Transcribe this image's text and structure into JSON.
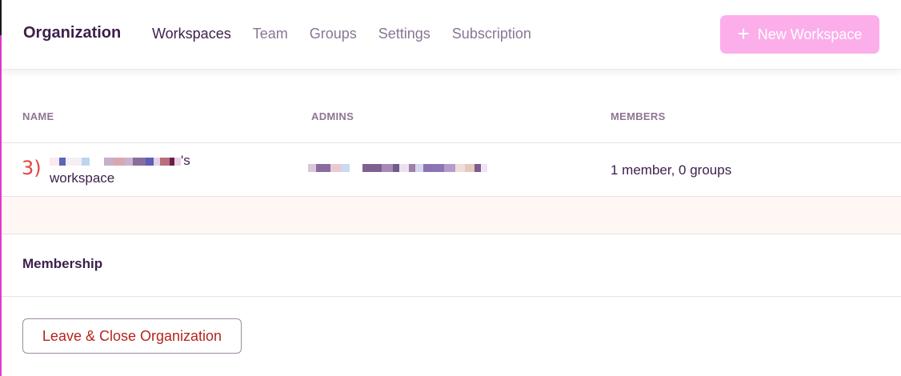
{
  "header": {
    "title": "Organization",
    "tabs": [
      {
        "label": "Workspaces",
        "active": true
      },
      {
        "label": "Team",
        "active": false
      },
      {
        "label": "Groups",
        "active": false
      },
      {
        "label": "Settings",
        "active": false
      },
      {
        "label": "Subscription",
        "active": false
      }
    ],
    "new_workspace_label": "New Workspace",
    "new_workspace_icon": "plus-icon"
  },
  "table": {
    "columns": [
      "NAME",
      "ADMINS",
      "MEMBERS"
    ],
    "rows": [
      {
        "index_label": "3)",
        "name_suffix": "'s",
        "name_second_line": "workspace",
        "members": "1 member, 0 groups"
      }
    ]
  },
  "membership": {
    "title": "Membership",
    "leave_label": "Leave & Close Organization"
  },
  "colors": {
    "accent_button": "#fbaeea",
    "danger_text": "#b3261e",
    "heading": "#3b1f4a",
    "muted": "#8a7593",
    "band": "#fff7f3",
    "edge": "#e13ad0"
  }
}
